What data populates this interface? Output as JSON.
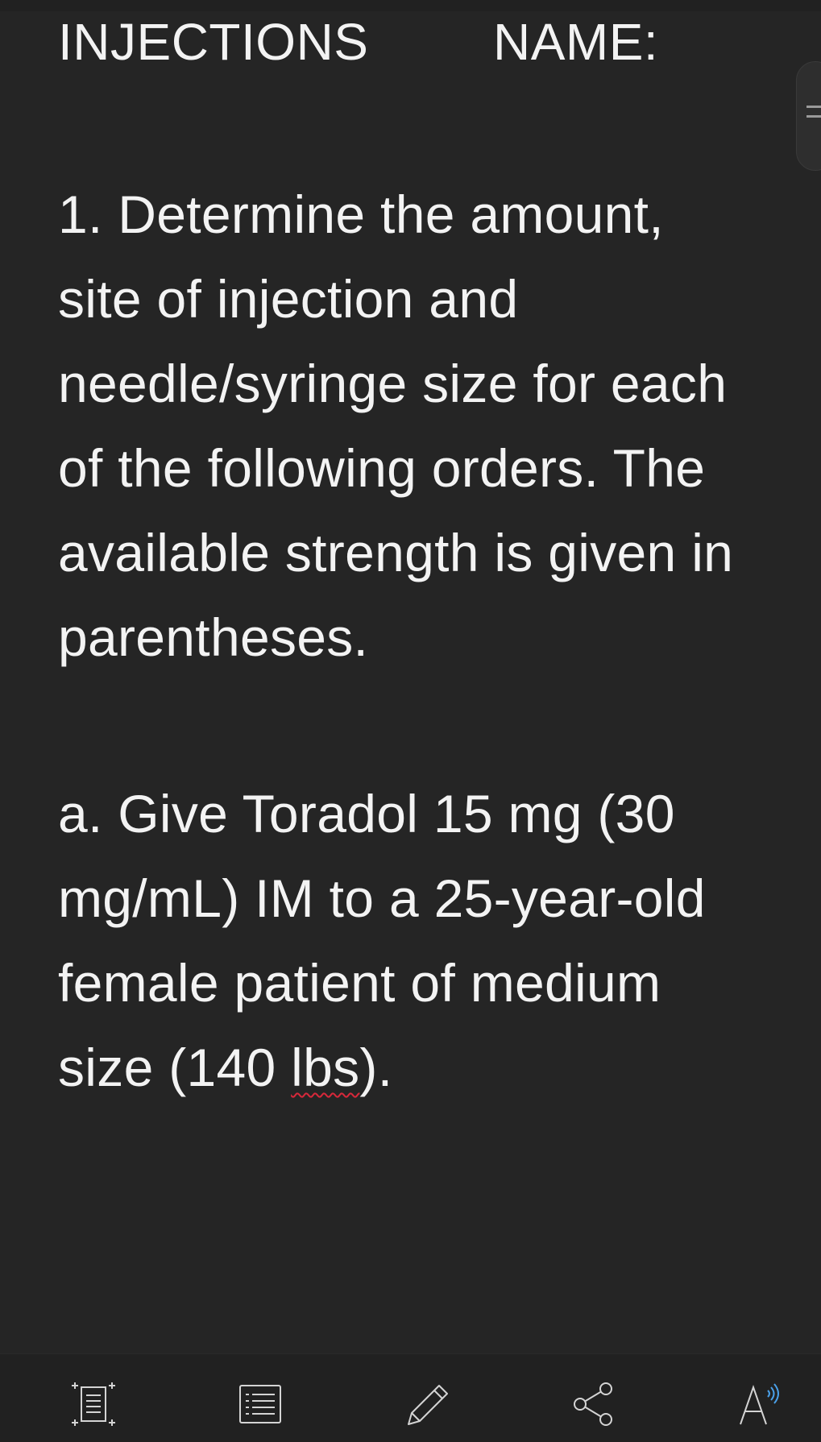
{
  "document": {
    "title": "INJECTIONS",
    "name_label": "NAME:",
    "question_lines": [
      "1. Determine the amount,",
      "site of injection and",
      "needle/syringe size for each",
      "of the following orders. The",
      "available strength is given in",
      "parentheses."
    ],
    "item_lines": [
      "a. Give Toradol 15 mg (30",
      "mg/mL) IM to a 25-year-old",
      "female patient of medium"
    ],
    "item_last_line": {
      "before": "size (140 ",
      "misspelled": "lbs",
      "after": ")."
    }
  },
  "toolbar": {
    "buttons": [
      {
        "icon": "page-fit-icon"
      },
      {
        "icon": "view-list-icon"
      },
      {
        "icon": "pencil-icon"
      },
      {
        "icon": "share-icon"
      },
      {
        "icon": "read-aloud-icon"
      }
    ]
  },
  "colors": {
    "background": "#252525",
    "toolbar_background": "#212121",
    "text": "#f3f3f3",
    "icon": "#d4d4d4",
    "accent": "#4aa0e8",
    "spelling_underline": "#d8283a"
  }
}
